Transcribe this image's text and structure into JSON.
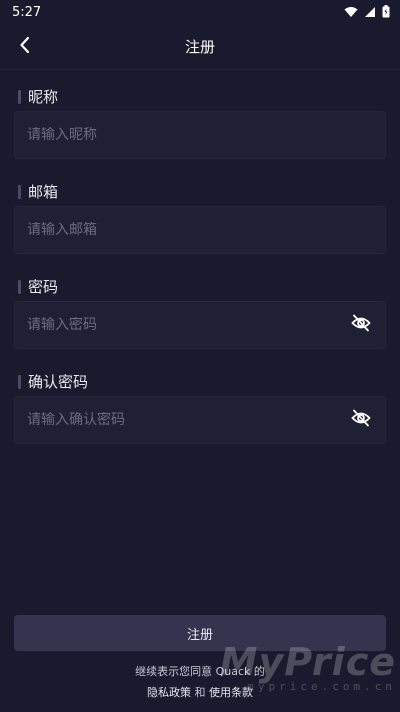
{
  "status_bar": {
    "time": "5:27"
  },
  "header": {
    "title": "注册"
  },
  "form": {
    "nickname": {
      "label": "昵称",
      "placeholder": "请输入昵称",
      "value": ""
    },
    "email": {
      "label": "邮箱",
      "placeholder": "请输入邮箱",
      "value": ""
    },
    "password": {
      "label": "密码",
      "placeholder": "请输入密码",
      "value": ""
    },
    "confirm_password": {
      "label": "确认密码",
      "placeholder": "请输入确认密码",
      "value": ""
    }
  },
  "submit_label": "注册",
  "terms": {
    "line1": "继续表示您同意 Quack 的",
    "privacy_policy": "隐私政策",
    "and": " 和 ",
    "terms_of_use": "使用条款"
  },
  "watermark": {
    "main": "MyPrice",
    "sub": "myprice.com.cn"
  },
  "colors": {
    "background": "#1a1a2e",
    "field_background": "#202035",
    "button_background": "#34344f",
    "placeholder": "#6b6b80"
  },
  "icons": [
    "wifi-icon",
    "signal-icon",
    "battery-icon",
    "back-arrow-icon",
    "eye-off-icon"
  ]
}
